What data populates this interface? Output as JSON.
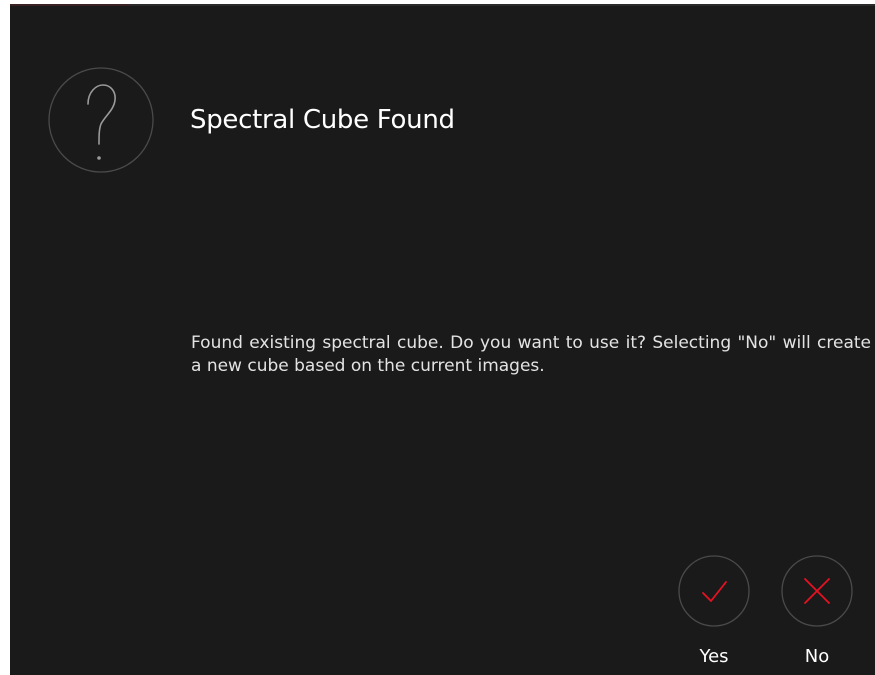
{
  "dialog": {
    "title": "Spectral Cube Found",
    "message": "Found existing spectral cube. Do you want to use it? Selecting \"No\" will create a new cube based on the current images.",
    "icon": "question-mark-icon"
  },
  "buttons": {
    "yes": {
      "label": "Yes",
      "icon": "checkmark-icon"
    },
    "no": {
      "label": "No",
      "icon": "close-icon"
    }
  },
  "colors": {
    "background": "#1a1a1a",
    "accent": "#e81123",
    "text": "#ffffff",
    "ring": "#4a4a4a"
  }
}
